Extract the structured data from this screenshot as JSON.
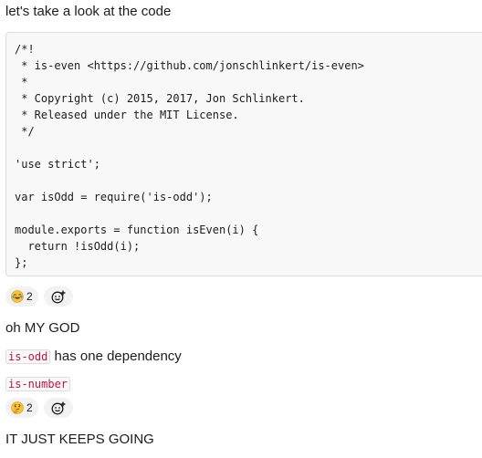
{
  "messages": {
    "intro": "let's take a look at the code",
    "code_lines": [
      "/*!",
      " * is-even <https://github.com/jonschlinkert/is-even>",
      " *",
      " * Copyright (c) 2015, 2017, Jon Schlinkert.",
      " * Released under the MIT License.",
      " */",
      "",
      "'use strict';",
      "",
      "var isOdd = require('is-odd');",
      "",
      "module.exports = function isEven(i) {",
      "  return !isOdd(i);",
      "};"
    ],
    "reaction1": {
      "emoji": "joy-emoji",
      "count": "2"
    },
    "omg": "oh MY GOD",
    "is_odd_code": "is-odd",
    "dependency_text": " has one dependency",
    "is_number_code": "is-number",
    "reaction2": {
      "emoji": "thinking-emoji",
      "count": "2"
    },
    "keeps_going": "IT JUST KEEPS GOING"
  }
}
